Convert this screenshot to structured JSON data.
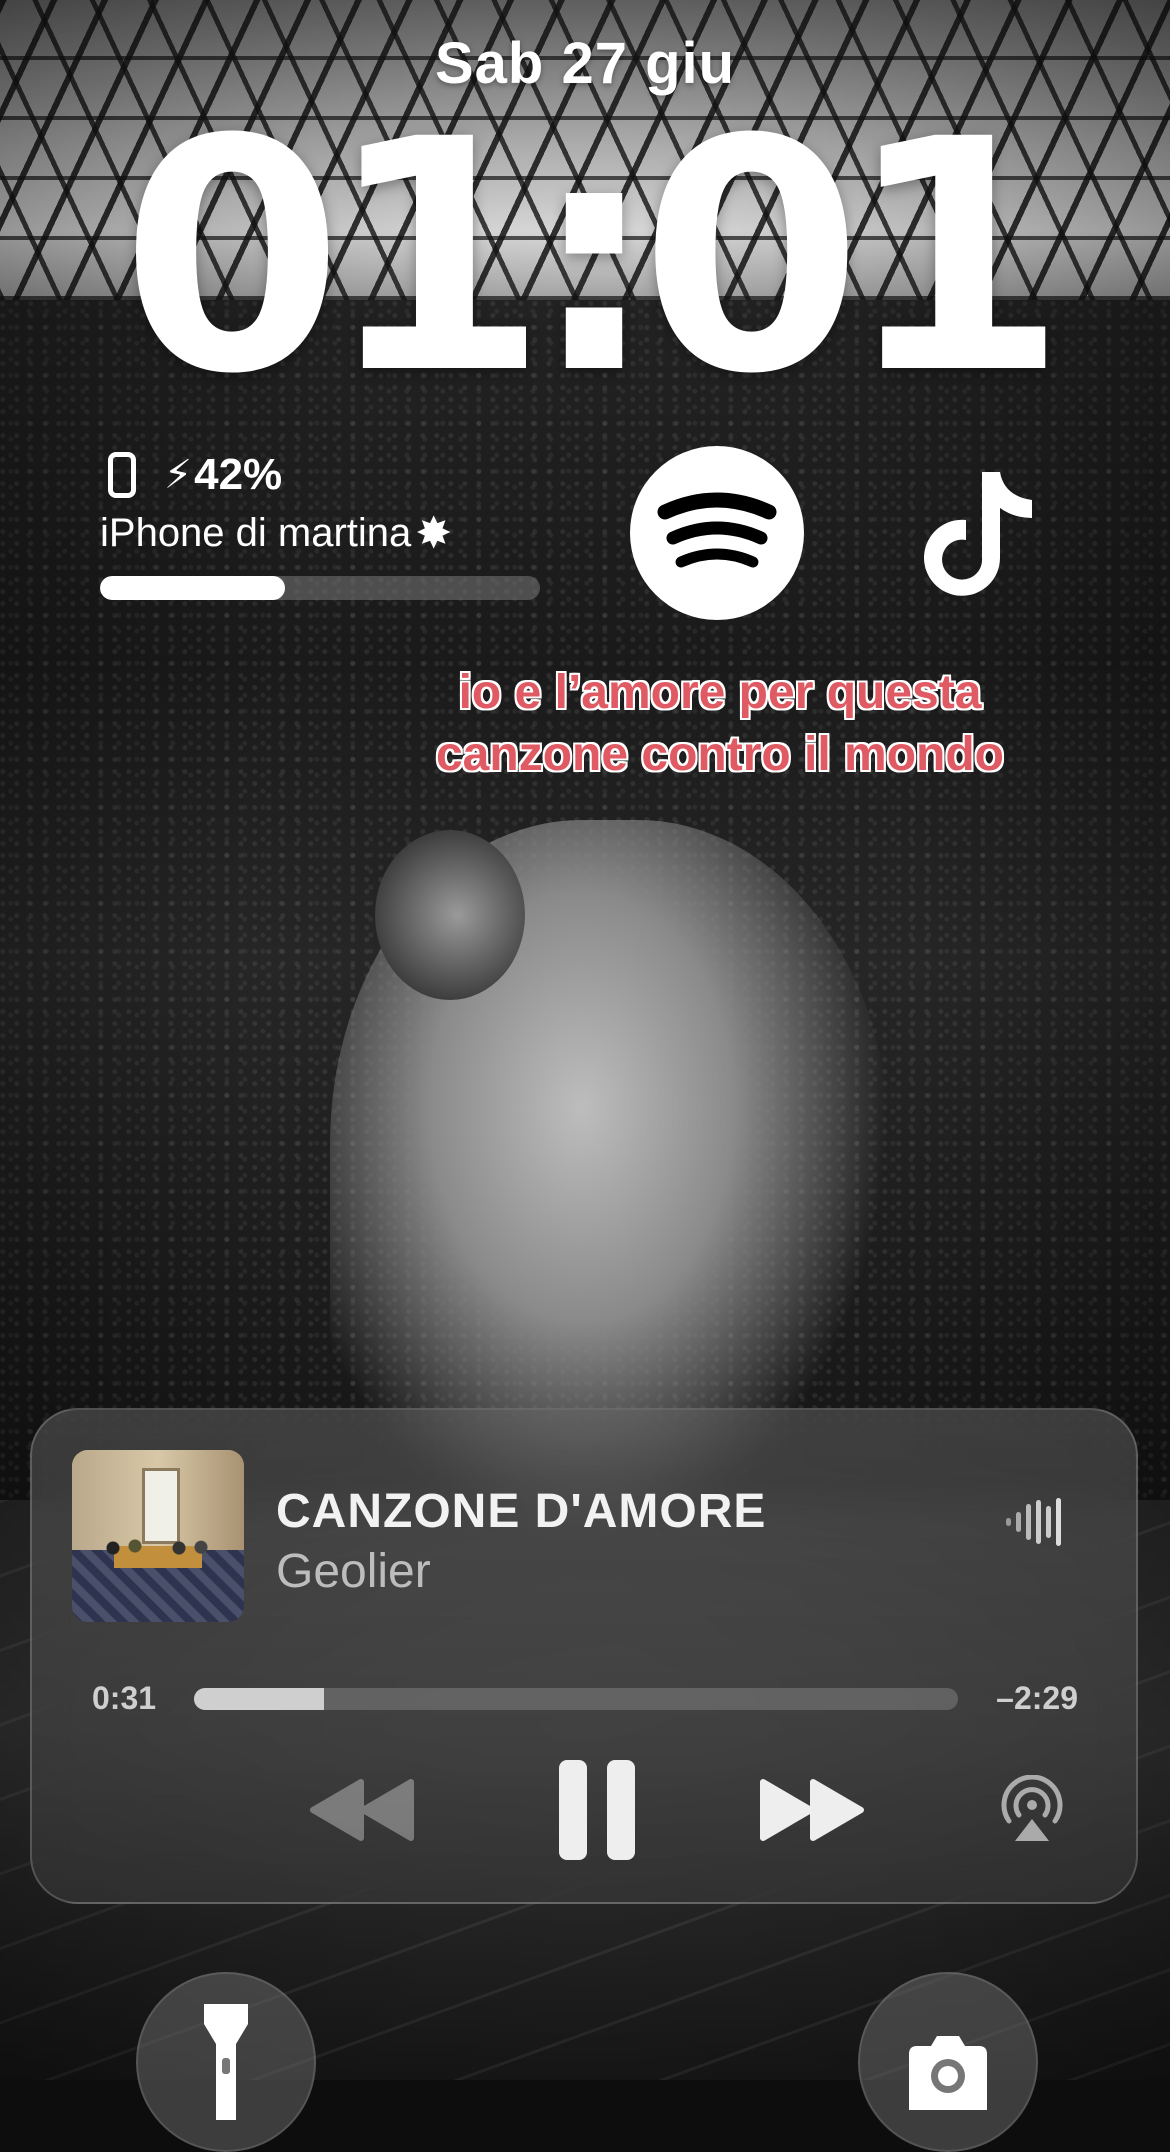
{
  "lock_screen": {
    "date": "Sab 27 giu",
    "time": "01:01"
  },
  "widgets": {
    "battery": {
      "percent_text": "42%",
      "level": 0.42,
      "device_name": "iPhone di martina",
      "icon": "phone-icon",
      "charging_icon": "bolt-icon",
      "device_icon": "sparkle-icon"
    },
    "spotify": {
      "icon": "spotify-logo-icon"
    },
    "tiktok": {
      "icon": "tiktok-logo-icon"
    }
  },
  "lyric": {
    "line1": "io e l’amore per questa",
    "line2": "canzone contro il mondo",
    "color": "#e05a64"
  },
  "now_playing": {
    "title": "CANZONE D'AMORE",
    "artist": "Geolier",
    "elapsed": "0:31",
    "remaining": "–2:29",
    "progress": 0.17,
    "controls": {
      "rewind": "rewind-icon",
      "pause": "pause-icon",
      "forward": "forward-icon",
      "airplay": "airplay-icon"
    },
    "visualizer_icon": "waveform-icon"
  },
  "quick_actions": {
    "left": "flashlight-icon",
    "right": "camera-icon"
  }
}
